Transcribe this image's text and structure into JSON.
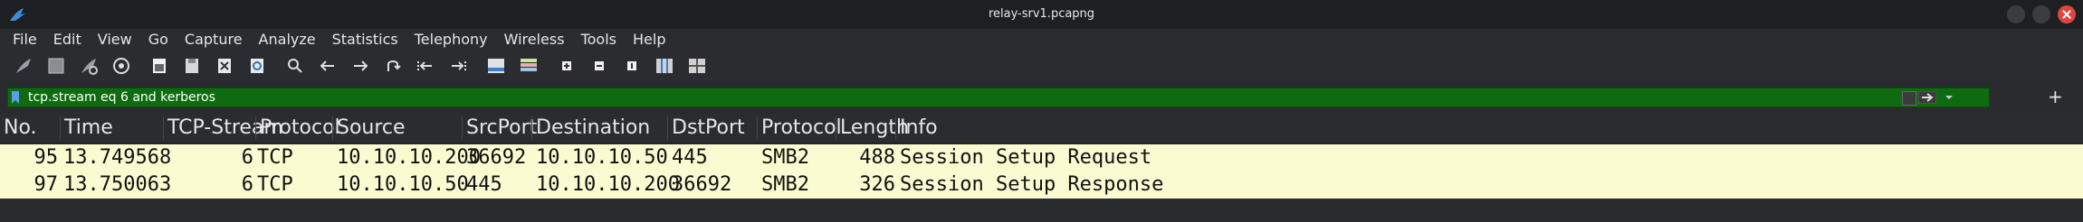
{
  "window": {
    "title": "relay-srv1.pcapng"
  },
  "menu": [
    "File",
    "Edit",
    "View",
    "Go",
    "Capture",
    "Analyze",
    "Statistics",
    "Telephony",
    "Wireless",
    "Tools",
    "Help"
  ],
  "toolbar_icons": [
    "start-capture-icon",
    "stop-capture-icon",
    "restart-capture-icon",
    "capture-options-icon",
    "open-file-icon",
    "save-file-icon",
    "close-file-icon",
    "reload-file-icon",
    "find-packet-icon",
    "go-back-icon",
    "go-forward-icon",
    "go-to-packet-icon",
    "first-packet-icon",
    "last-packet-icon",
    "autoscroll-icon",
    "colorize-icon",
    "zoom-in-icon",
    "zoom-out-icon",
    "normal-size-icon",
    "resize-columns-icon",
    "layout-icon"
  ],
  "filter": {
    "value": "tcp.stream eq 6 and kerberos"
  },
  "columns": [
    "No.",
    "Time",
    "TCP-Stream",
    "Protocol",
    "Source",
    "SrcPort",
    "Destination",
    "DstPort",
    "Protocol",
    "Length",
    "Info"
  ],
  "rows": [
    {
      "no": "95",
      "time": "13.749568",
      "stream": "6",
      "proto1": "TCP",
      "source": "10.10.10.200",
      "srcport": "36692",
      "destination": "10.10.10.50",
      "dstport": "445",
      "proto2": "SMB2",
      "length": "488",
      "info": "Session Setup Request"
    },
    {
      "no": "97",
      "time": "13.750063",
      "stream": "6",
      "proto1": "TCP",
      "source": "10.10.10.50",
      "srcport": "445",
      "destination": "10.10.10.200",
      "dstport": "36692",
      "proto2": "SMB2",
      "length": "326",
      "info": "Session Setup Response"
    }
  ],
  "colors": {
    "row_bg": "#fbfbd2",
    "filter_bg": "#0e6b10",
    "close_btn": "#e0443e"
  }
}
